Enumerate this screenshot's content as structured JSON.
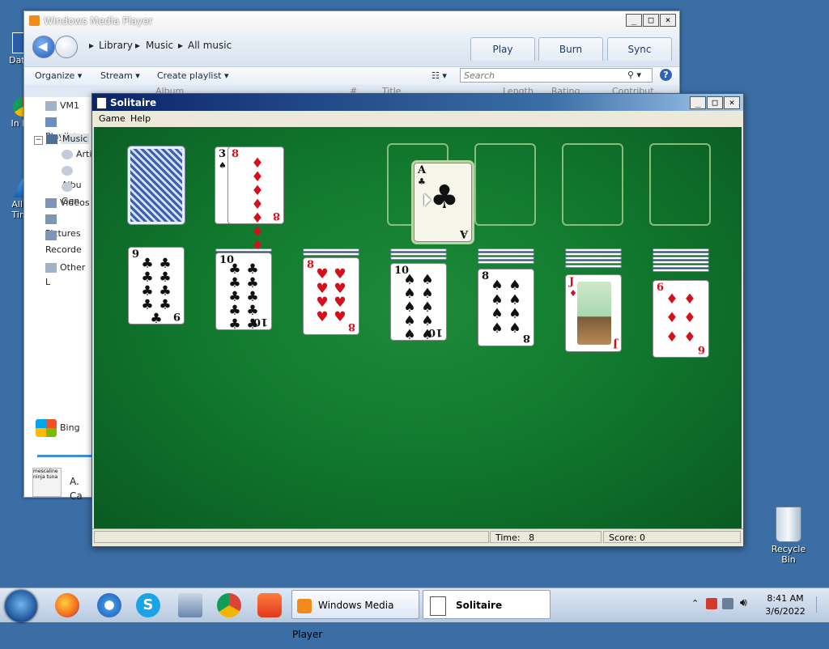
{
  "desktop": {
    "icons": [
      {
        "label": "DataV",
        "icon": "shortcut-icon"
      },
      {
        "label": "In Do",
        "icon": "chrome-shortcut-icon"
      },
      {
        "label": "All In Time",
        "icon": "shortcut-icon"
      },
      {
        "label": "Recycle Bin",
        "icon": "recycle-bin-icon"
      }
    ]
  },
  "wmp": {
    "title": "Windows Media Player",
    "breadcrumb": [
      "Library",
      "Music",
      "All music"
    ],
    "tabs": [
      "Play",
      "Burn",
      "Sync"
    ],
    "toolbar": {
      "organize": "Organize",
      "stream": "Stream",
      "create_playlist": "Create playlist"
    },
    "search_placeholder": "Search",
    "columns": [
      "Album",
      "#",
      "Title",
      "Length",
      "Rating",
      "Contribut..."
    ],
    "sidebar": {
      "items": [
        "VM1",
        "Playlists",
        "Music",
        "Arti",
        "Albu",
        "Gen",
        "Videos",
        "Pictures",
        "Recorde",
        "Other L"
      ],
      "bing": "Bing",
      "now_playing": "A. Ca",
      "thumb_text": "mescaline ninja tuna"
    }
  },
  "solitaire": {
    "title": "Solitaire",
    "menu": [
      "Game",
      "Help"
    ],
    "status": {
      "time_label": "Time:",
      "time_value": "8",
      "score_label": "Score:",
      "score_value": "0"
    },
    "waste_card": {
      "rank": "8",
      "suit": "♦",
      "under_rank": "3",
      "under_suit": "♠"
    },
    "dragging_card": {
      "rank": "A",
      "suit": "♣"
    },
    "tableau": [
      {
        "rank": "9",
        "suit": "♣",
        "color": "blk"
      },
      {
        "rank": "10",
        "suit": "♣",
        "color": "blk"
      },
      {
        "rank": "8",
        "suit": "♥",
        "color": "red"
      },
      {
        "rank": "10",
        "suit": "♠",
        "color": "blk"
      },
      {
        "rank": "8",
        "suit": "♠",
        "color": "blk"
      },
      {
        "rank": "J",
        "suit": "♦",
        "color": "red"
      },
      {
        "rank": "6",
        "suit": "♦",
        "color": "red"
      }
    ]
  },
  "taskbar": {
    "tasks": [
      {
        "label": "Windows Media Player"
      },
      {
        "label": "Solitaire"
      }
    ],
    "clock": {
      "time": "8:41 AM",
      "date": "3/6/2022"
    }
  },
  "colors": {
    "felt": "#117a2e",
    "desktop": "#3a6ea5",
    "red_suit": "#d4101a"
  }
}
